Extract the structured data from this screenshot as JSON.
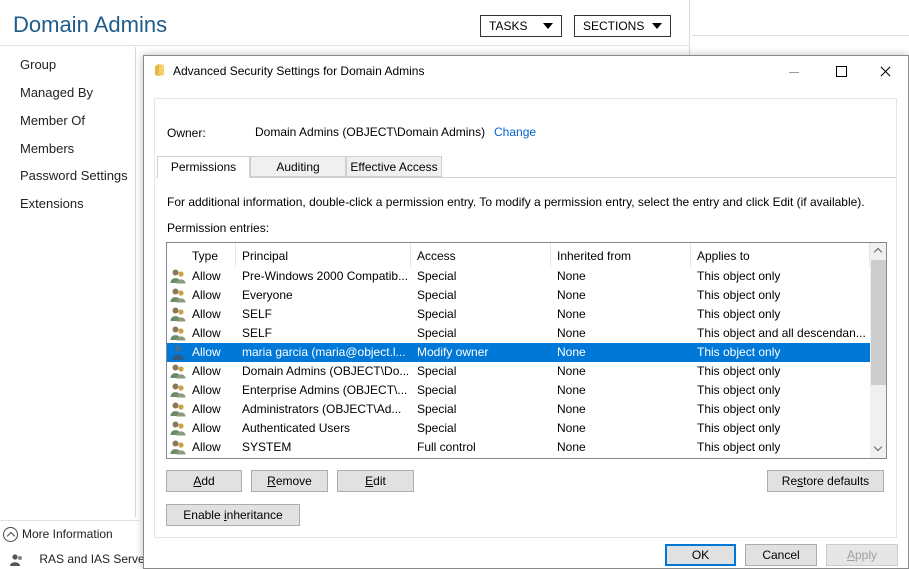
{
  "background_window": {
    "title": "Domain Admins",
    "tasks_label": "TASKS",
    "sections_label": "SECTIONS",
    "nav_items": [
      "Group",
      "Managed By",
      "Member Of",
      "Members",
      "Password Settings",
      "Extensions"
    ],
    "more_information_label": "More Information",
    "ras_label": "RAS and IAS Server"
  },
  "dialog": {
    "title": "Advanced Security Settings for Domain Admins",
    "owner_label": "Owner:",
    "owner_value": "Domain Admins (OBJECT\\Domain Admins)",
    "change_link": "Change",
    "tabs": [
      "Permissions",
      "Auditing",
      "Effective Access"
    ],
    "active_tab": "Permissions",
    "info_text": "For additional information, double-click a permission entry. To modify a permission entry, select the entry and click Edit (if available).",
    "entries_label": "Permission entries:",
    "columns": [
      "Type",
      "Principal",
      "Access",
      "Inherited from",
      "Applies to"
    ],
    "rows": [
      {
        "type": "Allow",
        "principal": "Pre-Windows 2000 Compatib...",
        "access": "Special",
        "inherited": "None",
        "applies": "This object only",
        "icon": "group-icon"
      },
      {
        "type": "Allow",
        "principal": "Everyone",
        "access": "Special",
        "inherited": "None",
        "applies": "This object only",
        "icon": "group-icon"
      },
      {
        "type": "Allow",
        "principal": "SELF",
        "access": "Special",
        "inherited": "None",
        "applies": "This object only",
        "icon": "group-icon"
      },
      {
        "type": "Allow",
        "principal": "SELF",
        "access": "Special",
        "inherited": "None",
        "applies": "This object and all descendan...",
        "icon": "group-icon"
      },
      {
        "type": "Allow",
        "principal": "maria garcia (maria@object.l...",
        "access": "Modify owner",
        "inherited": "None",
        "applies": "This object only",
        "icon": "user-icon",
        "selected": true
      },
      {
        "type": "Allow",
        "principal": "Domain Admins (OBJECT\\Do...",
        "access": "Special",
        "inherited": "None",
        "applies": "This object only",
        "icon": "group-icon"
      },
      {
        "type": "Allow",
        "principal": "Enterprise Admins (OBJECT\\...",
        "access": "Special",
        "inherited": "None",
        "applies": "This object only",
        "icon": "group-icon"
      },
      {
        "type": "Allow",
        "principal": "Administrators (OBJECT\\Ad...",
        "access": "Special",
        "inherited": "None",
        "applies": "This object only",
        "icon": "group-icon"
      },
      {
        "type": "Allow",
        "principal": "Authenticated Users",
        "access": "Special",
        "inherited": "None",
        "applies": "This object only",
        "icon": "group-icon"
      },
      {
        "type": "Allow",
        "principal": "SYSTEM",
        "access": "Full control",
        "inherited": "None",
        "applies": "This object only",
        "icon": "group-icon"
      }
    ],
    "buttons": {
      "add": {
        "before": "",
        "key": "A",
        "after": "dd"
      },
      "remove": {
        "before": "",
        "key": "R",
        "after": "emove"
      },
      "edit": {
        "before": "",
        "key": "E",
        "after": "dit"
      },
      "restore": {
        "before": "Re",
        "key": "s",
        "after": "tore defaults"
      },
      "enable_inheritance": {
        "before": "Enable ",
        "key": "i",
        "after": "nheritance"
      },
      "ok": "OK",
      "cancel": "Cancel",
      "apply": {
        "before": "",
        "key": "A",
        "after": "pply"
      }
    }
  },
  "colors": {
    "title_blue": "#1e5c8c",
    "selection": "#0078d7",
    "link": "#0066cc"
  }
}
